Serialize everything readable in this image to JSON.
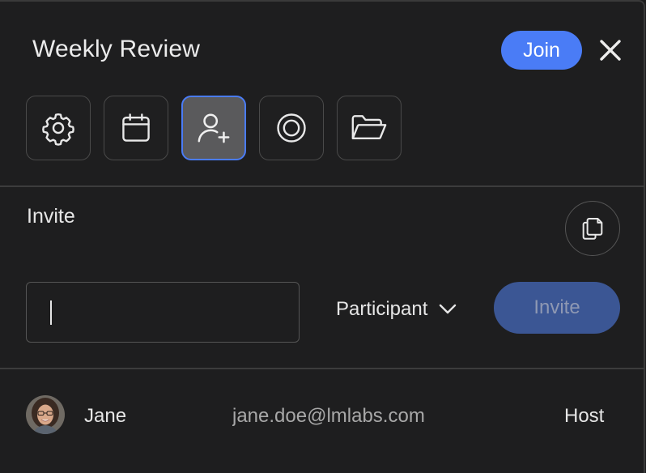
{
  "header": {
    "title": "Weekly Review",
    "join_label": "Join",
    "close_icon": "close-icon"
  },
  "toolbar": {
    "items": [
      {
        "icon": "settings-icon",
        "active": false
      },
      {
        "icon": "calendar-icon",
        "active": false
      },
      {
        "icon": "add-user-icon",
        "active": true
      },
      {
        "icon": "record-icon",
        "active": false
      },
      {
        "icon": "folder-icon",
        "active": false
      }
    ]
  },
  "invite": {
    "label": "Invite",
    "copy_icon": "copy-link-icon",
    "input_value": "",
    "input_placeholder": "",
    "role_selected": "Participant",
    "button_label": "Invite"
  },
  "members": [
    {
      "name": "Jane",
      "email": "jane.doe@lmlabs.com",
      "role": "Host"
    }
  ],
  "colors": {
    "background": "#1e1e1f",
    "accent": "#4a7cf6",
    "disabled_accent": "#3b5694",
    "border": "#4a4a4a"
  }
}
